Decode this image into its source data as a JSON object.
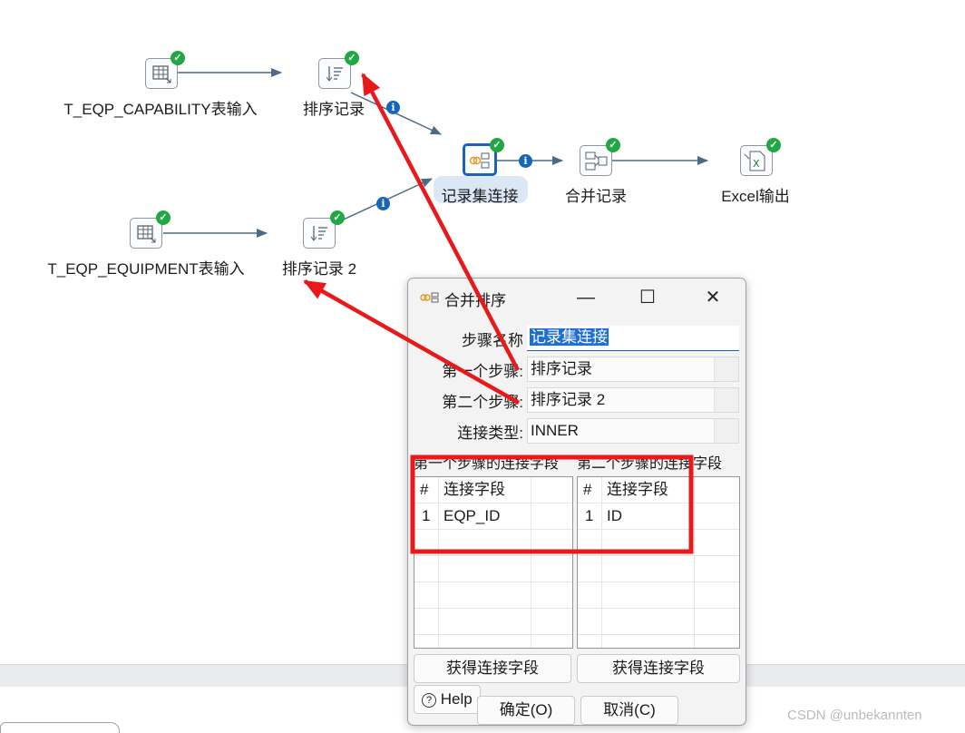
{
  "canvas": {
    "steps": [
      {
        "id": "capability-input",
        "label": "T_EQP_CAPABILITY表输入",
        "icon": "table-input-icon"
      },
      {
        "id": "sort1",
        "label": "排序记录",
        "icon": "sort-icon"
      },
      {
        "id": "merge-join",
        "label": "记录集连接",
        "icon": "merge-join-icon"
      },
      {
        "id": "merge",
        "label": "合并记录",
        "icon": "merge-rows-icon"
      },
      {
        "id": "excel-out",
        "label": "Excel输出",
        "icon": "excel-output-icon"
      },
      {
        "id": "equipment-input",
        "label": "T_EQP_EQUIPMENT表输入",
        "icon": "table-input-icon"
      },
      {
        "id": "sort2",
        "label": "排序记录 2",
        "icon": "sort-icon"
      }
    ],
    "status_icon": "check-icon",
    "info_icon": "info-icon"
  },
  "dialog": {
    "title": "合并排序",
    "minimize": "—",
    "maximize": "☐",
    "close": "✕",
    "step_name_label": "步骤名称",
    "step_name_value": "记录集连接",
    "first_step_label": "第一个步骤:",
    "first_step_value": "排序记录",
    "second_step_label": "第二个步骤:",
    "second_step_value": "排序记录 2",
    "join_type_label": "连接类型:",
    "join_type_value": "INNER",
    "first_keys_label": "第一个步骤的连接字段",
    "second_keys_label": "第二个步骤的连接字段",
    "left_table": {
      "col_num": "#",
      "col_field": "连接字段",
      "rows": [
        {
          "num": "1",
          "field": "EQP_ID"
        }
      ]
    },
    "right_table": {
      "col_num": "#",
      "col_field": "连接字段",
      "rows": [
        {
          "num": "1",
          "field": "ID"
        }
      ]
    },
    "get_fields_left": "获得连接字段",
    "get_fields_right": "获得连接字段",
    "help": "Help",
    "ok": "确定(O)",
    "cancel": "取消(C)"
  },
  "annotation_color": "#e8191b",
  "watermark": "CSDN @unbekannten"
}
